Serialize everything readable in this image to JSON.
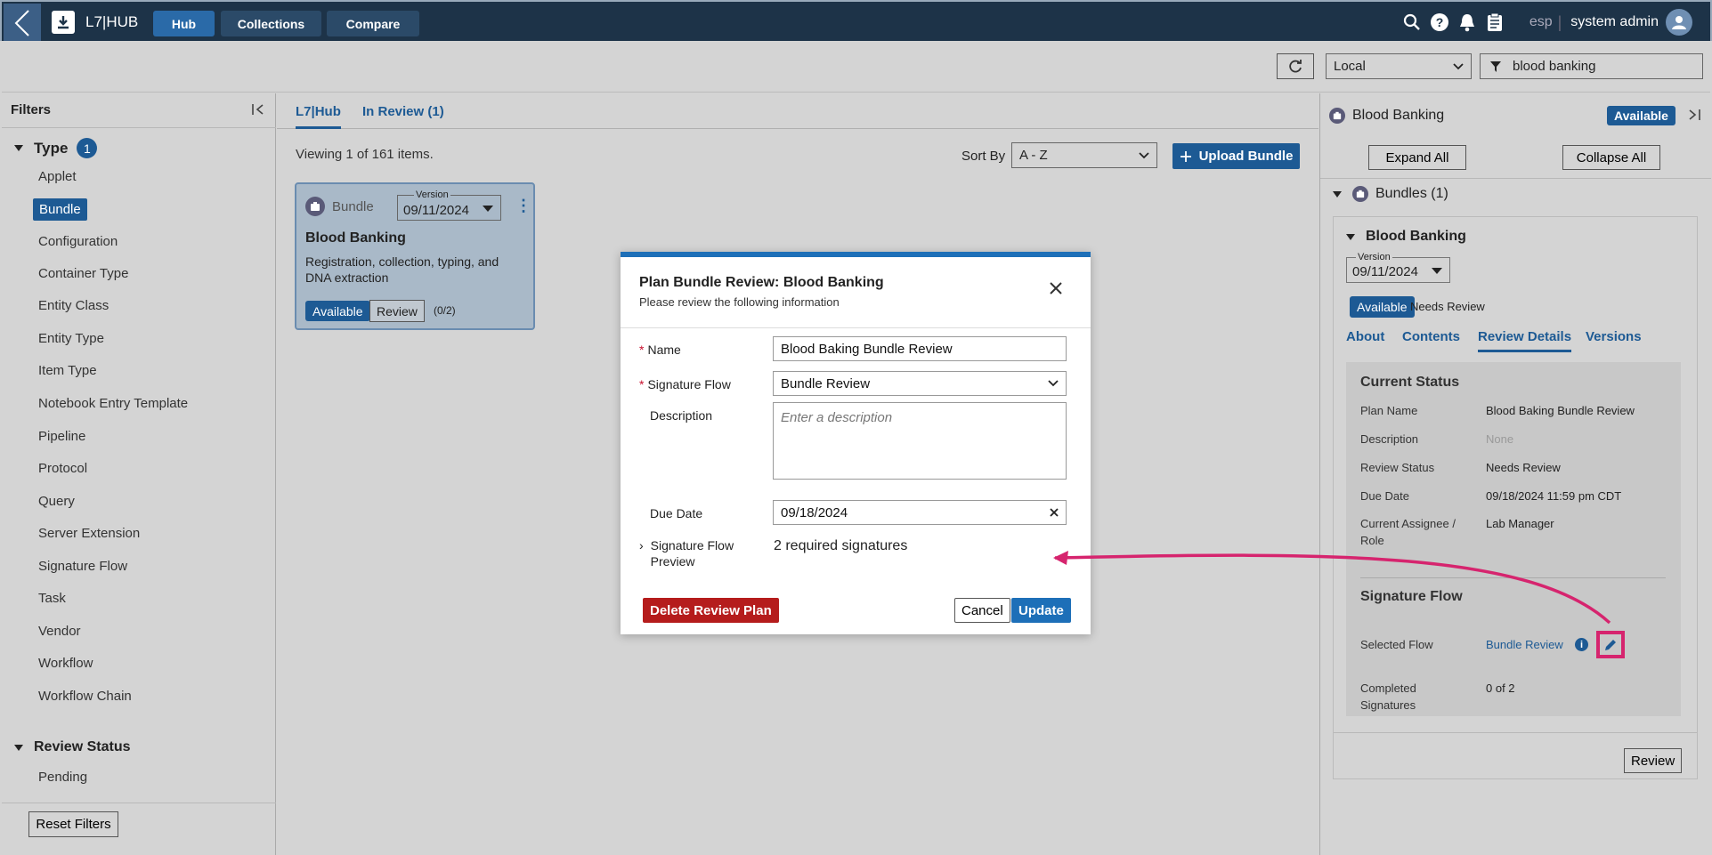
{
  "app": {
    "logo_text": "L7|HUB"
  },
  "nav": {
    "tabs": [
      {
        "label": "Hub"
      },
      {
        "label": "Collections"
      },
      {
        "label": "Compare"
      }
    ]
  },
  "topbar": {
    "lang": "esp",
    "separator": "|",
    "user": "system admin"
  },
  "toolbar": {
    "scope_value": "Local",
    "filter_value": "blood banking"
  },
  "filters": {
    "title": "Filters",
    "type_group": {
      "label": "Type",
      "count": "1"
    },
    "type_items": [
      "Applet",
      "Bundle",
      "Configuration",
      "Container Type",
      "Entity Class",
      "Entity Type",
      "Item Type",
      "Notebook Entry Template",
      "Pipeline",
      "Protocol",
      "Query",
      "Server Extension",
      "Signature Flow",
      "Task",
      "Vendor",
      "Workflow",
      "Workflow Chain"
    ],
    "review_group": {
      "label": "Review Status"
    },
    "review_items": [
      "Pending"
    ],
    "reset_label": "Reset Filters"
  },
  "main": {
    "tabs": [
      "L7|Hub",
      "In Review (1)"
    ],
    "viewing": "Viewing 1 of 161 items.",
    "sort_label": "Sort By",
    "sort_value": "A - Z",
    "upload_label": "Upload Bundle",
    "card": {
      "type": "Bundle",
      "version_label": "Version",
      "version": "09/11/2024",
      "title": "Blood Banking",
      "description": "Registration, collection, typing, and DNA extraction",
      "status": "Available",
      "review_label": "Review",
      "review_count": "(0/2)"
    }
  },
  "right_panel": {
    "title": "Blood Banking",
    "status": "Available",
    "expand_label": "Expand All",
    "collapse_label": "Collapse All",
    "bundles_label": "Bundles (1)",
    "bundle_name": "Blood Banking",
    "version_label": "Version",
    "version": "09/11/2024",
    "pill": "Available",
    "review_state": "Needs Review",
    "tabs": [
      "About",
      "Contents",
      "Review Details",
      "Versions"
    ],
    "current_status": {
      "heading": "Current Status",
      "rows": [
        {
          "k": "Plan Name",
          "v": "Blood Baking Bundle Review"
        },
        {
          "k": "Description",
          "v": "None"
        },
        {
          "k": "Review Status",
          "v": "Needs Review"
        },
        {
          "k": "Due Date",
          "v": "09/18/2024 11:59 pm CDT"
        },
        {
          "k": "Current Assignee / Role",
          "v": "Lab Manager"
        }
      ]
    },
    "signature_flow": {
      "heading": "Signature Flow",
      "selected_label": "Selected Flow",
      "selected_value": "Bundle Review",
      "completed_label": "Completed Signatures",
      "completed_value": "0 of 2"
    },
    "review_button": "Review"
  },
  "modal": {
    "title": "Plan Bundle Review: Blood Banking",
    "subtitle": "Please review the following information",
    "name_label": "Name",
    "name_value": "Blood Baking Bundle Review",
    "flow_label": "Signature Flow",
    "flow_value": "Bundle Review",
    "desc_label": "Description",
    "desc_placeholder": "Enter a description",
    "due_label": "Due Date",
    "due_value": "09/18/2024",
    "preview_label": "Signature Flow Preview",
    "preview_value": "2 required signatures",
    "delete_label": "Delete Review Plan",
    "cancel_label": "Cancel",
    "update_label": "Update"
  },
  "colors": {
    "accent": "#1d5a94",
    "danger": "#b51c1c",
    "highlight": "#d6246e"
  }
}
